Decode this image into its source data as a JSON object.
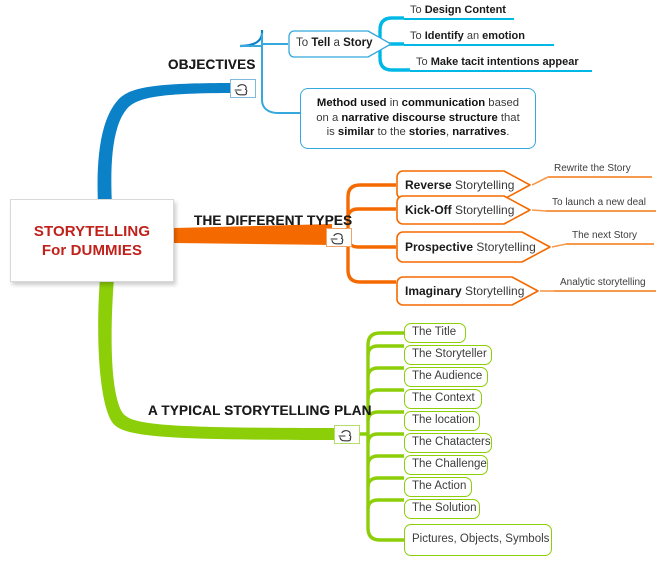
{
  "colors": {
    "blue": "#0b81c8",
    "cyan": "#00b8e6",
    "blue_outline": "#35a8dd",
    "orange": "#f56a00",
    "orange_light": "#f79a4d",
    "green": "#8cce08",
    "root_text": "#c1211b",
    "text": "#3d3d3d",
    "text_bold": "#1a1a1a"
  },
  "root": {
    "line1": "STORYTELLING",
    "line2": "For DUMMIES"
  },
  "branches": [
    {
      "id": "objectives",
      "title": "OBJECTIVES",
      "color": "#0b81c8",
      "icon": "pointing-hand-icon",
      "children": [
        {
          "label_prefix": "To ",
          "label_bold": "Tell",
          "label_mid": " a ",
          "label_bold2": "Story",
          "type": "arrow-callout",
          "children": [
            {
              "prefix": "To ",
              "bold": "Design Content",
              "suffix": ""
            },
            {
              "prefix": "To ",
              "bold": "Identify",
              "mid": " an ",
              "bold2": "emotion",
              "suffix": ""
            },
            {
              "prefix": "To ",
              "bold": "Make tacit intentions appear",
              "suffix": ""
            }
          ]
        },
        {
          "type": "paragraph",
          "text": "Method used in communication based on a narrative discourse structure that is similar to the stories, narratives."
        }
      ]
    },
    {
      "id": "types",
      "title": "THE DIFFERENT TYPES",
      "color": "#f56a00",
      "icon": "pointing-hand-icon",
      "children": [
        {
          "bold": "Reverse",
          "rest": " Storytelling",
          "note": "Rewrite the Story"
        },
        {
          "bold": "Kick-Off",
          "rest": " Storytelling",
          "note": "To launch a new deal"
        },
        {
          "bold": "Prospective",
          "rest": " Storytelling",
          "note": "The next Story"
        },
        {
          "bold": "Imaginary",
          "rest": " Storytelling",
          "note": "Analytic storytelling"
        }
      ]
    },
    {
      "id": "plan",
      "title": "A TYPICAL STORYTELLING PLAN",
      "color": "#8cce08",
      "icon": "pointing-hand-icon",
      "children": [
        {
          "label": "The Title"
        },
        {
          "label": "The Storyteller"
        },
        {
          "label": "The Audience"
        },
        {
          "label": "The Context"
        },
        {
          "label": "The location"
        },
        {
          "label": "The Chatacters"
        },
        {
          "label": "The Challenge"
        },
        {
          "label": "The Action"
        },
        {
          "label": "The Solution"
        },
        {
          "label": "Pictures, Objects, Symbols"
        }
      ]
    }
  ],
  "paragraph_parts": {
    "p1": "Method used",
    "p2": " in ",
    "p3": "communication",
    "p4": " based on a ",
    "p5": "narrative discourse structure",
    "p6": " that is ",
    "p7": "similar",
    "p8": " to the ",
    "p9": "stories",
    "p10": ", ",
    "p11": "narratives",
    "p12": "."
  }
}
